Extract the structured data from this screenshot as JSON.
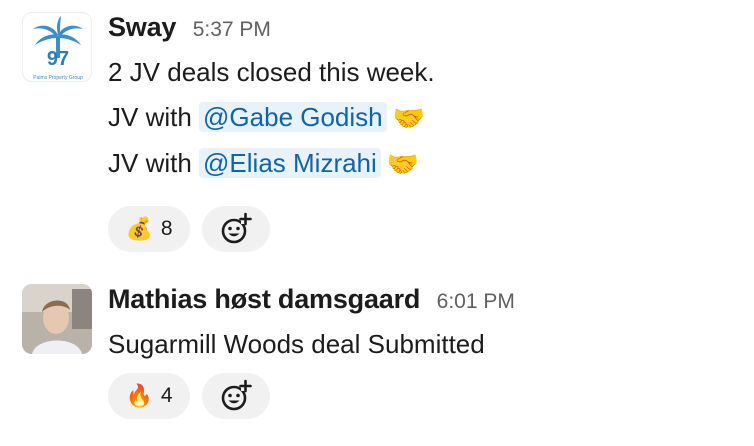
{
  "messages": [
    {
      "sender": "Sway",
      "time": "5:37 PM",
      "avatar": {
        "label": "97",
        "subtext": "Palms Property Group",
        "icon": "palm-tree-icon",
        "color": "#3a8fc9"
      },
      "lines": [
        {
          "text": "2 JV deals closed this week."
        },
        {
          "prefix": "JV with ",
          "mention": "@Gabe Godish",
          "emoji": "🤝"
        },
        {
          "prefix": "JV with ",
          "mention": "@Elias Mizrahi",
          "emoji": "🤝"
        }
      ],
      "reactions": [
        {
          "emoji": "💰",
          "count": "8",
          "icon": "money-bag-icon"
        }
      ],
      "add_reaction_icon": "add-emoji-icon"
    },
    {
      "sender": "Mathias høst damsgaard",
      "time": "6:01 PM",
      "avatar": {
        "icon": "user-photo-avatar"
      },
      "lines": [
        {
          "text": "Sugarmill Woods deal Submitted"
        }
      ],
      "reactions": [
        {
          "emoji": "🔥",
          "count": "4",
          "icon": "fire-icon"
        }
      ],
      "add_reaction_icon": "add-emoji-icon"
    }
  ],
  "colors": {
    "mention_bg": "#e8f2fb",
    "mention_text": "#1264a3",
    "reaction_bg": "#f1f1f1",
    "timestamp": "#616061"
  }
}
